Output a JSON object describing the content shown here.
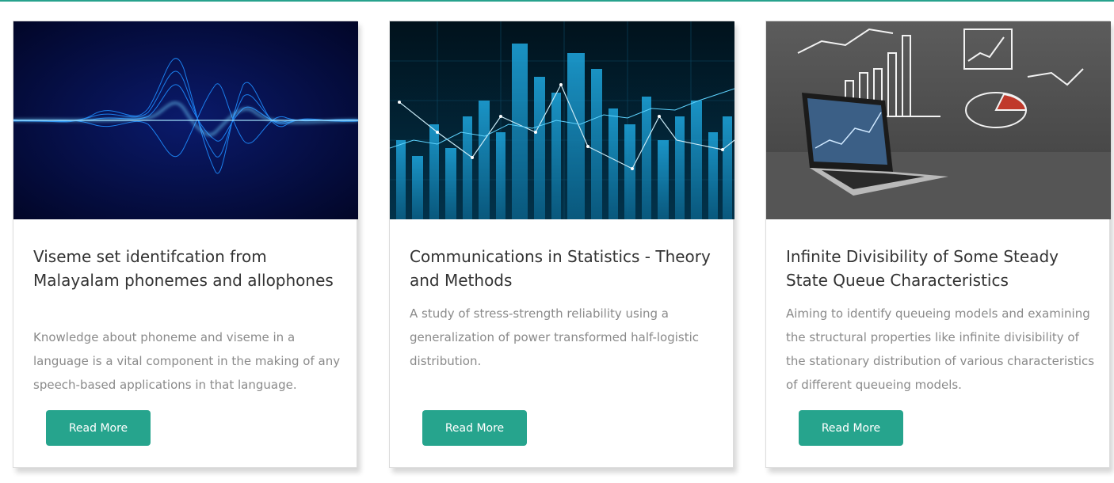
{
  "cards": [
    {
      "image": "sound-wave-illustration",
      "title": "Viseme set identifcation from Malayalam phonemes and allophones",
      "description": "Knowledge about phoneme and viseme in a language is a vital component in the making of any speech-based applications in that language.",
      "button_label": "Read More"
    },
    {
      "image": "stock-chart-illustration",
      "title": "Communications in Statistics - Theory and Methods",
      "description": "A study of stress-strength reliability using a generalization of power transformed half-logistic distribution.",
      "button_label": "Read More"
    },
    {
      "image": "laptop-with-charts-illustration",
      "title": "Infinite Divisibility of Some Steady State Queue Characteristics",
      "description": "Aiming to identify queueing models and examining the structural properties like infinite divisibility of the stationary distribution of various characteristics of different queueing models.",
      "button_label": "Read More"
    }
  ],
  "colors": {
    "accent": "#26a48d",
    "title": "#333333",
    "body": "#8a8a8a"
  }
}
